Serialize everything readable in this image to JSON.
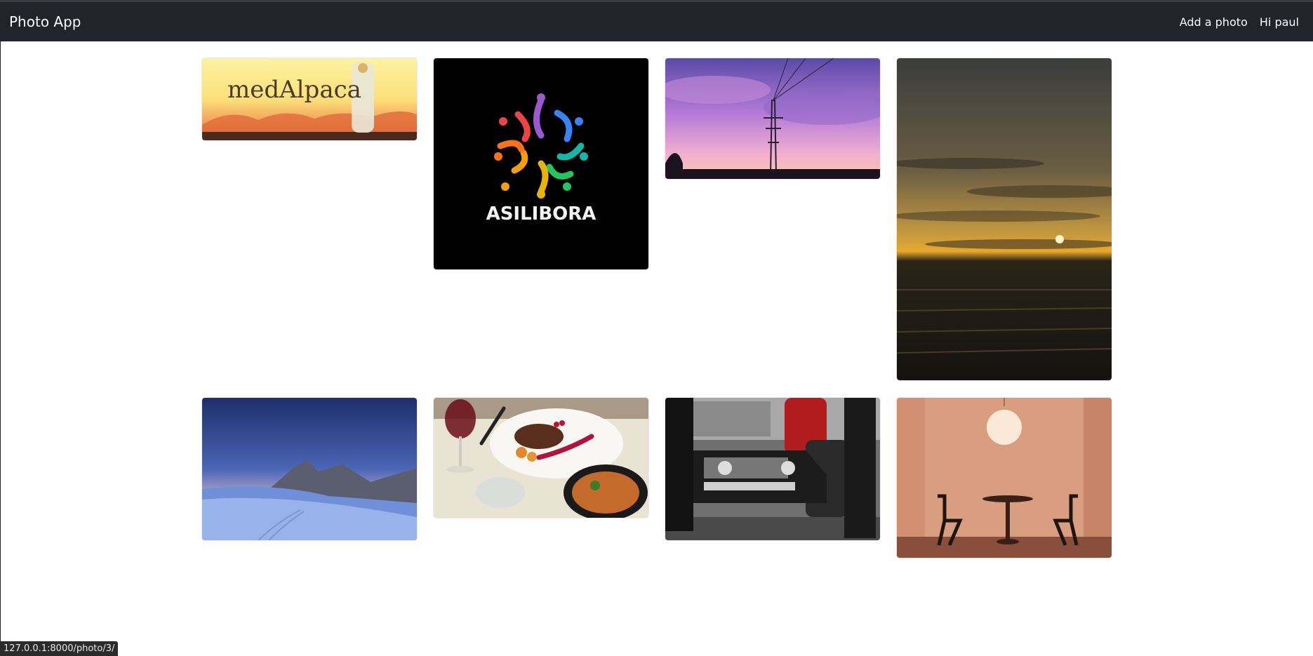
{
  "navbar": {
    "brand": "Photo App",
    "add_photo": "Add a photo",
    "greeting": "Hi paul"
  },
  "photos": [
    {
      "id": "medalpaca",
      "text": "medAlpaca"
    },
    {
      "id": "asilibora",
      "text": "ASILIBORA"
    },
    {
      "id": "power-line-sunset"
    },
    {
      "id": "ocean-sunset"
    },
    {
      "id": "snowy-mountain"
    },
    {
      "id": "steak-dinner"
    },
    {
      "id": "classic-car"
    },
    {
      "id": "pink-room-table"
    }
  ],
  "status_bar": {
    "url": "127.0.0.1:8000/photo/3/"
  },
  "colors": {
    "navbar": "#212529",
    "page_bg": "#ffffff"
  }
}
